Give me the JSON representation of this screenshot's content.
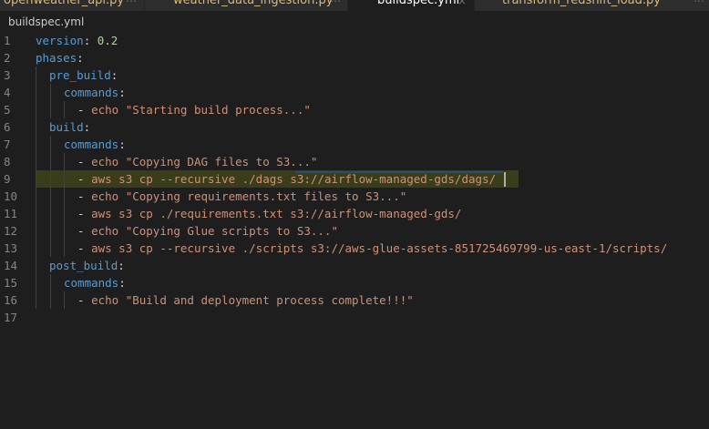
{
  "tabs": [
    {
      "label": "openweather_api.py",
      "close": "⋯"
    },
    {
      "label": "weather_data_ingestion.py",
      "close": "⋯"
    },
    {
      "label": "buildspec.yml",
      "close": "×",
      "active": true
    },
    {
      "label": "transform_redshift_load.py",
      "close": "⋯"
    }
  ],
  "breadcrumb": {
    "file": "buildspec.yml"
  },
  "editor": {
    "line_numbers": [
      "1",
      "2",
      "3",
      "4",
      "5",
      "6",
      "7",
      "8",
      "9",
      "10",
      "11",
      "12",
      "13",
      "14",
      "15",
      "16",
      "17"
    ],
    "lines": {
      "l1": {
        "key": "version",
        "colon": ":",
        "value": "0.2"
      },
      "l2": {
        "key": "phases",
        "colon": ":"
      },
      "l3": {
        "key": "pre_build",
        "colon": ":"
      },
      "l4": {
        "key": "commands",
        "colon": ":"
      },
      "l5": {
        "dash": "-",
        "text": "echo \"Starting build process...\""
      },
      "l6": {
        "key": "build",
        "colon": ":"
      },
      "l7": {
        "key": "commands",
        "colon": ":"
      },
      "l8": {
        "dash": "-",
        "text": "echo \"Copying DAG files to S3...\""
      },
      "l9": {
        "dash": "-",
        "text_a": "aws s3 cp --recursive ./dags ",
        "text_b": "s3://airflow-managed-gds/dags/"
      },
      "l10": {
        "dash": "-",
        "text": "echo \"Copying requirements.txt files to S3...\""
      },
      "l11": {
        "dash": "-",
        "text": "aws s3 cp ./requirements.txt s3://airflow-managed-gds/"
      },
      "l12": {
        "dash": "-",
        "text": "echo \"Copying Glue scripts to S3...\""
      },
      "l13": {
        "dash": "-",
        "text": "aws s3 cp --recursive ./scripts s3://aws-glue-assets-851725469799-us-east-1/scripts/"
      },
      "l14": {
        "key": "post_build",
        "colon": ":"
      },
      "l15": {
        "key": "commands",
        "colon": ":"
      },
      "l16": {
        "dash": "-",
        "text": "echo \"Build and deployment process complete!!!\""
      }
    }
  },
  "colors": {
    "background": "#1e1e1e",
    "key": "#569cd6",
    "string": "#ce9178",
    "number": "#b5cea8",
    "line_number": "#858585",
    "tab_label": "#d7ba7d"
  }
}
